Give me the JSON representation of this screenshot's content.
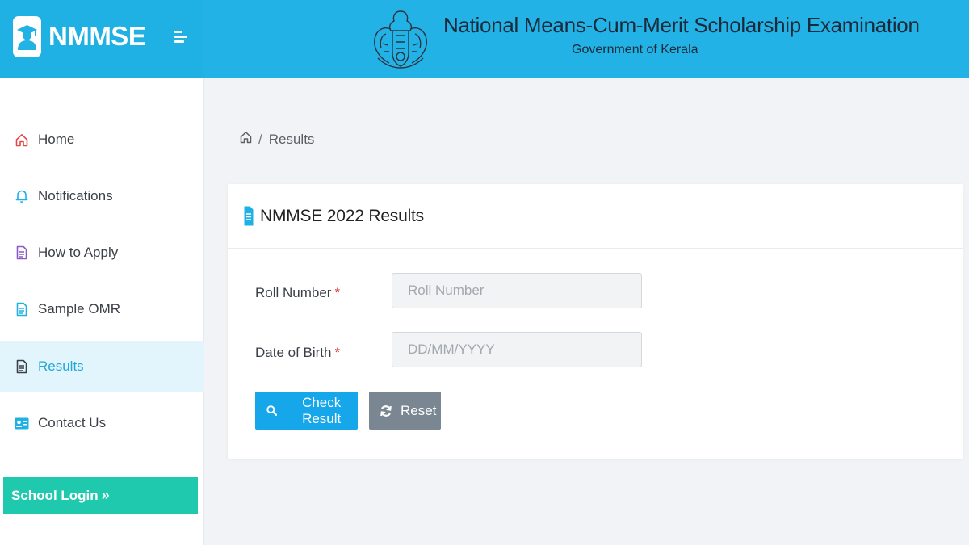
{
  "header": {
    "brand_name": "NMMSE",
    "title": "National Means-Cum-Merit Scholarship Examination",
    "subtitle": "Government of Kerala"
  },
  "sidebar": {
    "items": [
      {
        "label": "Home",
        "icon": "home-icon",
        "active": false
      },
      {
        "label": "Notifications",
        "icon": "bell-icon",
        "active": false
      },
      {
        "label": "How to Apply",
        "icon": "document-icon",
        "active": false
      },
      {
        "label": "Sample OMR",
        "icon": "document-icon",
        "active": false
      },
      {
        "label": "Results",
        "icon": "document-icon",
        "active": true
      },
      {
        "label": "Contact Us",
        "icon": "contact-card-icon",
        "active": false
      }
    ],
    "school_login": "School Login",
    "school_login_chevron": "»"
  },
  "breadcrumb": {
    "separator": "/",
    "current": "Results"
  },
  "card": {
    "title": "NMMSE 2022 Results"
  },
  "form": {
    "roll_number_label": "Roll Number",
    "roll_number_placeholder": "Roll Number",
    "roll_number_value": "",
    "dob_label": "Date of Birth",
    "dob_placeholder": "DD/MM/YYYY",
    "dob_value": "",
    "required_mark": "*",
    "check_button": "Check Result",
    "reset_button": "Reset"
  },
  "colors": {
    "header_bg": "#22b2e6",
    "accent": "#16a6ea",
    "school_login_bg": "#1fc9ad",
    "reset_bg": "#7a8691",
    "required": "#d63a3a",
    "active_nav_bg": "#e2f5fc"
  }
}
